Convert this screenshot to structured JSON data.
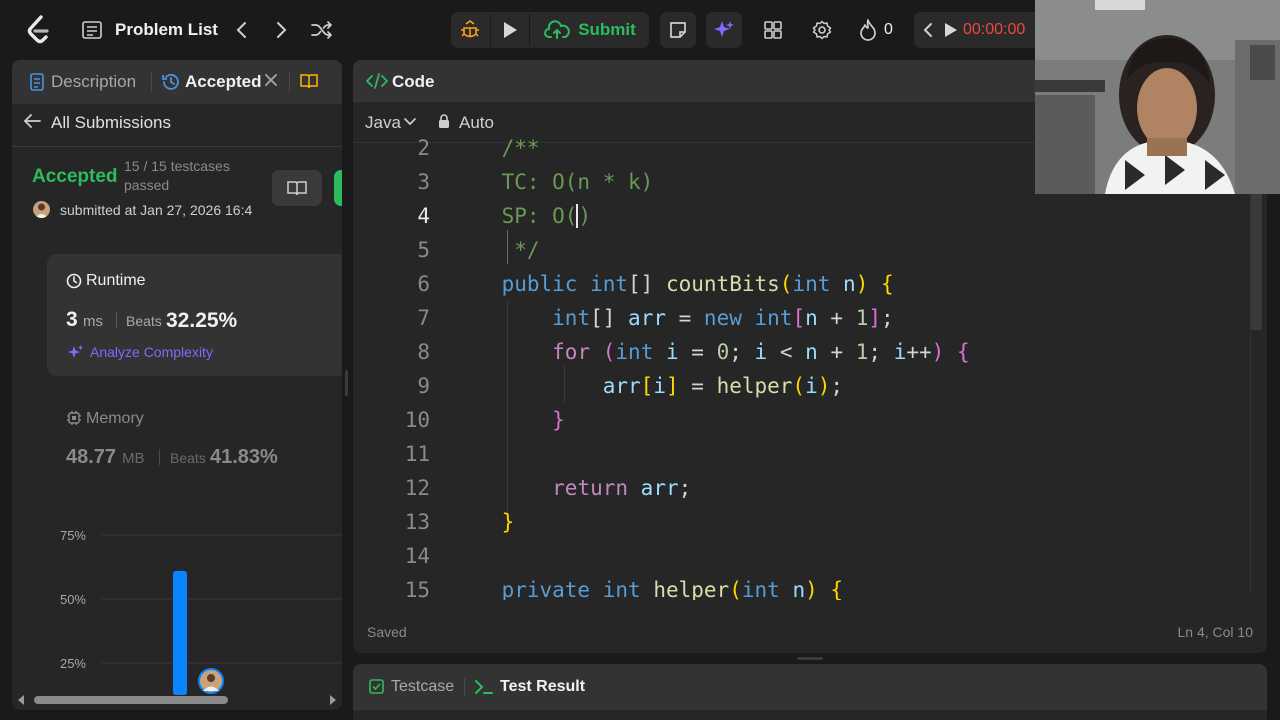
{
  "topbar": {
    "problem_list": "Problem List",
    "submit": "Submit",
    "streak": "0",
    "timer": "00:00:00"
  },
  "left_tabs": {
    "description": "Description",
    "accepted": "Accepted"
  },
  "submission": {
    "all_submissions": "All Submissions",
    "status": "Accepted",
    "testcases_line1": "15 / 15 testcases",
    "testcases_line2": "passed",
    "submitted_at": "submitted at Jan 27, 2026 16:4",
    "runtime_label": "Runtime",
    "runtime_value": "3",
    "runtime_unit": "ms",
    "beats_label": "Beats",
    "runtime_beats": "32.25%",
    "analyze": "Analyze Complexity",
    "memory_label": "Memory",
    "memory_value": "48.77",
    "memory_unit": "MB",
    "memory_beats": "41.83%"
  },
  "chart_data": {
    "type": "bar",
    "y_ticks": [
      "75%",
      "50%",
      "25%"
    ],
    "ylim": [
      0,
      75
    ],
    "highlight_bar_value": 61
  },
  "editor": {
    "tab": "Code",
    "language": "Java",
    "mode": "Auto",
    "status": "Saved",
    "cursor": "Ln 4, Col 10",
    "line_numbers": [
      "2",
      "3",
      "4",
      "5",
      "6",
      "7",
      "8",
      "9",
      "10",
      "11",
      "12",
      "13",
      "14",
      "15"
    ]
  },
  "bottom": {
    "testcase": "Testcase",
    "test_result": "Test Result"
  },
  "colors": {
    "accepted_green": "#2cbb5d",
    "accent_blue": "#0a84ff",
    "timer_red": "#ef4743"
  }
}
